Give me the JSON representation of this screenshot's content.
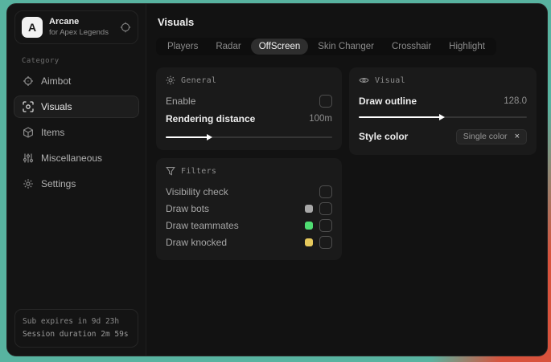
{
  "app": {
    "name": "Arcane",
    "subtitle": "for Apex Legends",
    "logo_letter": "A",
    "header_icon": "target-icon"
  },
  "sidebar": {
    "category_label": "Category",
    "items": [
      {
        "label": "Aimbot",
        "icon": "crosshair-icon",
        "active": false
      },
      {
        "label": "Visuals",
        "icon": "esp-eye-icon",
        "active": true
      },
      {
        "label": "Items",
        "icon": "cube-icon",
        "active": false
      },
      {
        "label": "Miscellaneous",
        "icon": "sliders-icon",
        "active": false
      },
      {
        "label": "Settings",
        "icon": "gear-icon",
        "active": false
      }
    ],
    "footer": {
      "line1": "Sub expires in 9d 23h",
      "line2": "Session duration 2m 59s"
    }
  },
  "header": {
    "title": "Visuals"
  },
  "tabs": [
    {
      "label": "Players",
      "active": false
    },
    {
      "label": "Radar",
      "active": false
    },
    {
      "label": "OffScreen",
      "active": true
    },
    {
      "label": "Skin Changer",
      "active": false
    },
    {
      "label": "Crosshair",
      "active": false
    },
    {
      "label": "Highlight",
      "active": false
    }
  ],
  "panels": {
    "general": {
      "title": "General",
      "icon": "sun-icon",
      "enable_label": "Enable",
      "enable_checked": false,
      "rendering_distance_label": "Rendering distance",
      "rendering_distance_value": "100m",
      "rendering_distance_percent": 27
    },
    "visual": {
      "title": "Visual",
      "icon": "eye-icon",
      "draw_outline_label": "Draw outline",
      "draw_outline_value": "128.0",
      "draw_outline_percent": 50,
      "style_color_label": "Style color",
      "style_color_value": "Single color",
      "style_color_clear_icon": "×"
    },
    "filters": {
      "title": "Filters",
      "icon": "funnel-icon",
      "rows": [
        {
          "label": "Visibility check",
          "checked": false
        },
        {
          "label": "Draw bots",
          "swatch": "#a8a8a8",
          "checked": false
        },
        {
          "label": "Draw teammates",
          "swatch": "#4fdd72",
          "checked": false
        },
        {
          "label": "Draw knocked",
          "swatch": "#e6c95c",
          "checked": false
        }
      ]
    }
  },
  "colors": {
    "desktop_teal": "#58b3a0",
    "desktop_red": "#d8523c",
    "window_bg": "#131313",
    "panel_bg": "#1a1a1a",
    "active_pill": "#2e2e2e",
    "slider_fill": "#ffffff"
  }
}
